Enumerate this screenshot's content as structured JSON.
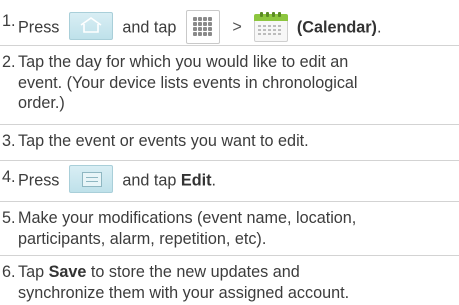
{
  "steps": [
    {
      "number": "1.",
      "text_press": "Press",
      "text_and_tap": "and tap",
      "text_gt": ">",
      "calendar_label": "(Calendar)",
      "text_end": "."
    },
    {
      "number": "2.",
      "lines": [
        "Tap the day for which you would like to edit an",
        "event. (Your device lists events in chronological",
        "order.)"
      ]
    },
    {
      "number": "3.",
      "lines": [
        "Tap the event or events you want to edit."
      ]
    },
    {
      "number": "4.",
      "text_press": "Press",
      "text_and_tap": "and tap",
      "edit_label": "Edit",
      "text_end": "."
    },
    {
      "number": "5.",
      "lines": [
        "Make your modifications (event name, location,",
        "participants, alarm, repetition, etc)."
      ]
    },
    {
      "number": "6.",
      "text_tap": "Tap",
      "save_label": "Save",
      "line1_rest": "to store the new updates and",
      "line2": "synchronize them with your assigned account."
    }
  ],
  "icons": {
    "home": "home-icon",
    "apps": "apps-grid-icon",
    "calendar": "calendar-icon",
    "menu": "menu-icon"
  }
}
